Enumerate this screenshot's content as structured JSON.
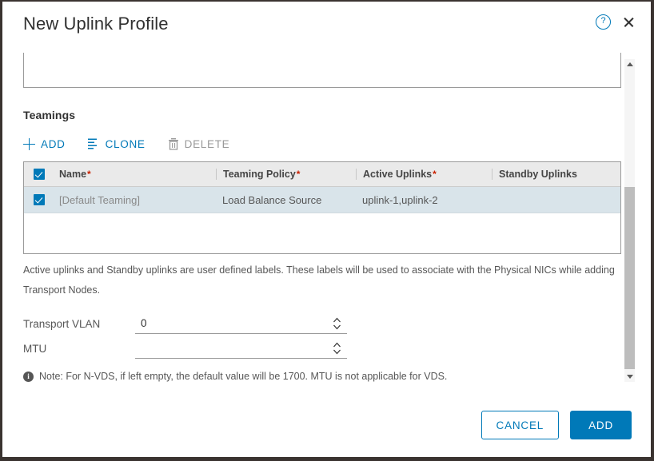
{
  "dialog": {
    "title": "New Uplink Profile",
    "help_icon": "help-circle-icon",
    "close_icon": "close-icon",
    "accent_color": "#0079b8",
    "required_color": "#c92100",
    "selected_row_color": "#d9e4ea"
  },
  "teamings": {
    "section_title": "Teamings",
    "toolbar": [
      {
        "label": "ADD",
        "icon": "plus-icon",
        "disabled": false
      },
      {
        "label": "CLONE",
        "icon": "clone-icon",
        "disabled": false
      },
      {
        "label": "DELETE",
        "icon": "trash-icon",
        "disabled": true
      }
    ],
    "columns": [
      {
        "label": "Name",
        "required": true
      },
      {
        "label": "Teaming Policy",
        "required": true
      },
      {
        "label": "Active Uplinks",
        "required": true
      },
      {
        "label": "Standby Uplinks",
        "required": false
      }
    ],
    "rows": [
      {
        "selected": true,
        "name": "[Default Teaming]",
        "teaming_policy": "Load Balance Source",
        "active_uplinks": "uplink-1,uplink-2",
        "standby_uplinks": ""
      }
    ],
    "helper_text": "Active uplinks and Standby uplinks are user defined labels. These labels will be used to associate with the Physical NICs while adding Transport Nodes."
  },
  "form": {
    "transport_vlan": {
      "label": "Transport VLAN",
      "value": "0",
      "placeholder": ""
    },
    "mtu": {
      "label": "MTU",
      "value": "",
      "placeholder": ""
    },
    "note": "Note: For N-VDS, if left empty, the default value will be 1700. MTU is not applicable for VDS.",
    "note_icon": "info-icon"
  },
  "footer": {
    "cancel_label": "CANCEL",
    "submit_label": "ADD"
  },
  "scrollbar": {
    "up_icon": "caret-up-icon",
    "down_icon": "caret-down-icon"
  }
}
